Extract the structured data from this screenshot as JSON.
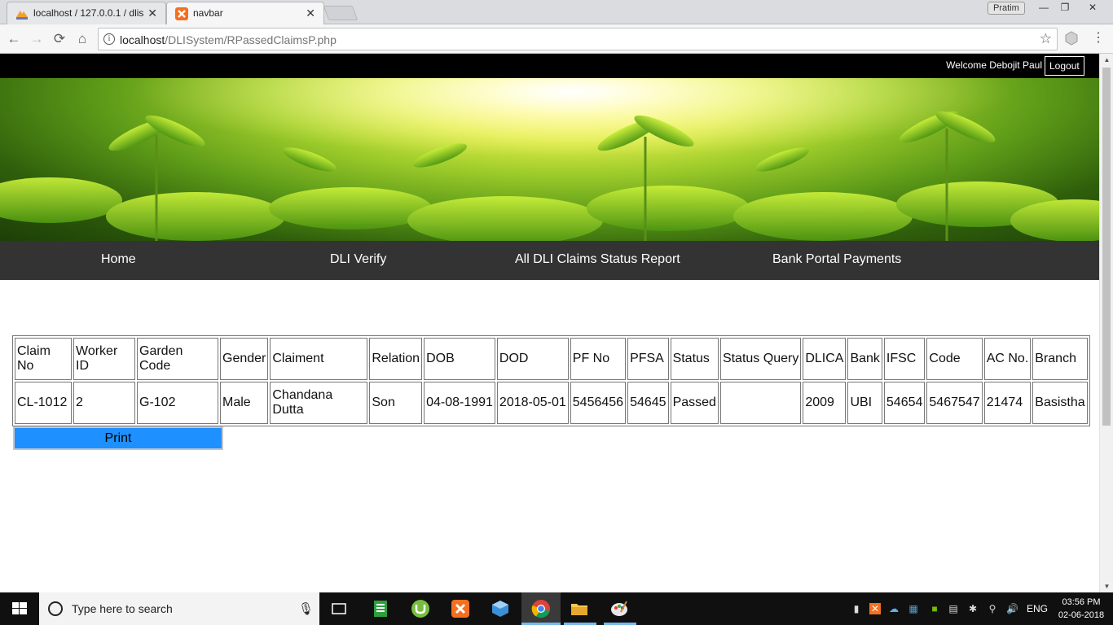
{
  "browser": {
    "tabs": [
      {
        "title": "localhost / 127.0.0.1 / dlis",
        "active": false
      },
      {
        "title": "navbar",
        "active": true
      }
    ],
    "profile_name": "Pratim",
    "url_host": "localhost",
    "url_path": "/DLISystem/RPassedClaimsP.php"
  },
  "header": {
    "welcome": "Welcome Debojit Paul",
    "logout": "Logout"
  },
  "nav": {
    "items": [
      "Home",
      "DLI Verify",
      "All DLI Claims Status Report",
      "Bank Portal Payments"
    ]
  },
  "claims_table": {
    "columns": [
      "Claim No",
      "Worker ID",
      "Garden Code",
      "Gender",
      "Claiment",
      "Relation",
      "DOB",
      "DOD",
      "PF No",
      "PFSA",
      "Status",
      "Status Query",
      "DLICA",
      "Bank",
      "IFSC",
      "Code",
      "AC No.",
      "Branch"
    ],
    "rows": [
      [
        "CL-1012",
        "2",
        "G-102",
        "Male",
        "Chandana Dutta",
        "Son",
        "04-08-1991",
        "2018-05-01",
        "5456456",
        "54645",
        "Passed",
        "",
        "2009",
        "UBI",
        "54654",
        "5467547",
        "21474",
        "Basistha"
      ]
    ]
  },
  "print_button": "Print",
  "taskbar": {
    "search_placeholder": "Type here to search",
    "language": "ENG",
    "time": "03:56 PM",
    "date": "02-06-2018"
  },
  "colors": {
    "topbar": "#000000",
    "navbar": "#333333",
    "print_button": "#1e90ff",
    "taskbar": "#101010"
  }
}
